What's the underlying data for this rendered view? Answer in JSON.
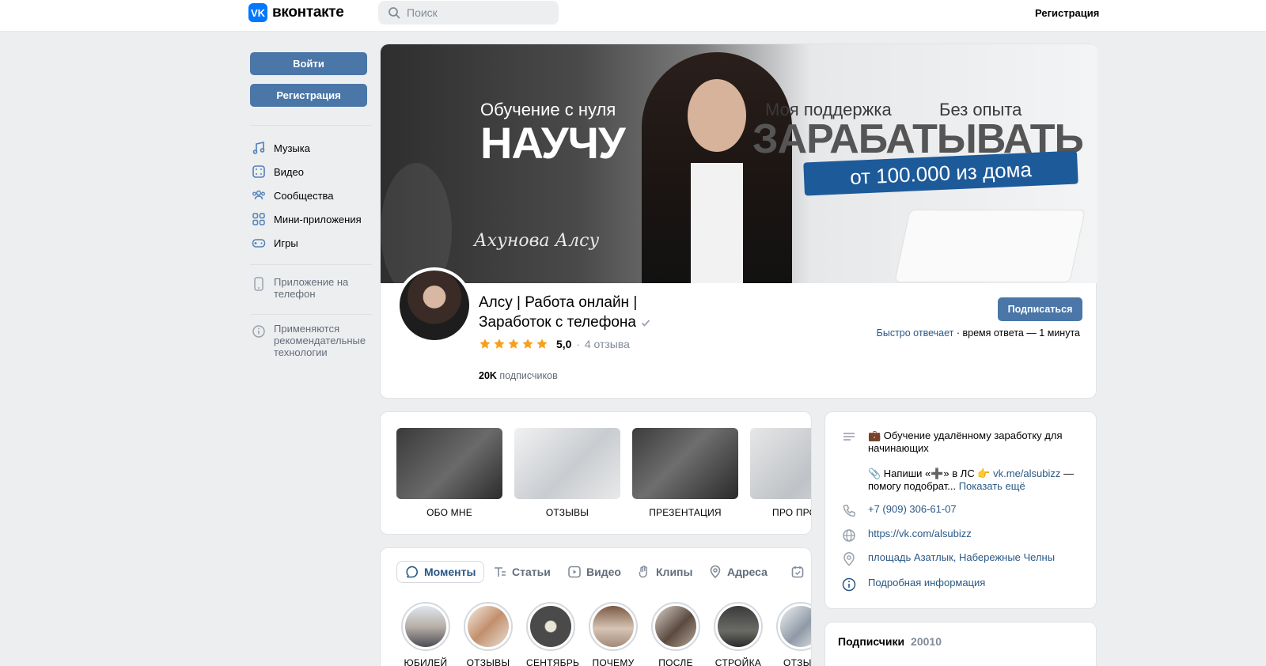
{
  "header": {
    "logo_mark": "VK",
    "logo_text": "вконтакте",
    "search_placeholder": "Поиск",
    "register_link": "Регистрация"
  },
  "sidebar": {
    "login_button": "Войти",
    "register_button": "Регистрация",
    "nav": [
      {
        "label": "Музыка",
        "icon": "music-icon"
      },
      {
        "label": "Видео",
        "icon": "video-icon"
      },
      {
        "label": "Сообщества",
        "icon": "communities-icon"
      },
      {
        "label": "Мини-приложения",
        "icon": "mini-apps-icon"
      },
      {
        "label": "Игры",
        "icon": "games-icon"
      }
    ],
    "app_note": "Приложение на телефон",
    "reco_note": "Применяются рекомендательные технологии"
  },
  "cover": {
    "line1": "Обучение с нуля",
    "line2": "НАУЧУ",
    "line3a": "Моя поддержка",
    "line3b": "Без опыта",
    "line4": "ЗАРАБАТЫВАТЬ",
    "banner": "от 100.000 из дома",
    "signature": "Ахунова Алсу"
  },
  "profile": {
    "name_line1": "Алсу | Работа онлайн |",
    "name_line2": "Заработок с телефона",
    "rating": "5,0",
    "reviews": "4 отзыва",
    "subscribers_count": "20K",
    "subscribers_word": "подписчиков",
    "subscribe_button": "Подписаться",
    "reply_speed": "Быстро отвечает",
    "reply_time": "время ответа — 1 минута"
  },
  "highlights": [
    {
      "label": "ОБО МНЕ"
    },
    {
      "label": "ОТЗЫВЫ"
    },
    {
      "label": "ПРЕЗЕНТАЦИЯ"
    },
    {
      "label": "ПРО ПРО"
    }
  ],
  "tabs": [
    {
      "label": "Моменты",
      "icon": "moments-icon"
    },
    {
      "label": "Статьи",
      "icon": "articles-icon"
    },
    {
      "label": "Видео",
      "icon": "video-icon"
    },
    {
      "label": "Клипы",
      "icon": "clips-icon"
    },
    {
      "label": "Адреса",
      "icon": "location-icon"
    }
  ],
  "moments": [
    {
      "label": "ЮБИЛЕЙ"
    },
    {
      "label": "ОТЗЫВЫ"
    },
    {
      "label": "СЕНТЯБРЬ"
    },
    {
      "label": "ПОЧЕМУ"
    },
    {
      "label": "ПОСЛЕ"
    },
    {
      "label": "СТРОЙКА"
    },
    {
      "label": "ОТЗЫВ"
    }
  ],
  "info": {
    "desc1": "💼 Обучение удалённому заработку для начинающих",
    "desc2_pre": "📎 Напиши «➕» в ЛС 👉",
    "desc2_link": "vk.me/alsubizz",
    "desc2_post": " — помогу подобрат...",
    "show_more": "Показать ещё",
    "phone": "+7 (909) 306-61-07",
    "site": "https://vk.com/alsubizz",
    "address": "площадь Азатлык, Набережные Челны",
    "details": "Подробная информация"
  },
  "followers": {
    "title": "Подписчики",
    "count": "20010"
  },
  "colors": {
    "accent": "#4a76a8",
    "link": "#2a5885",
    "vk_blue": "#0077ff",
    "star": "#f8a01c"
  }
}
